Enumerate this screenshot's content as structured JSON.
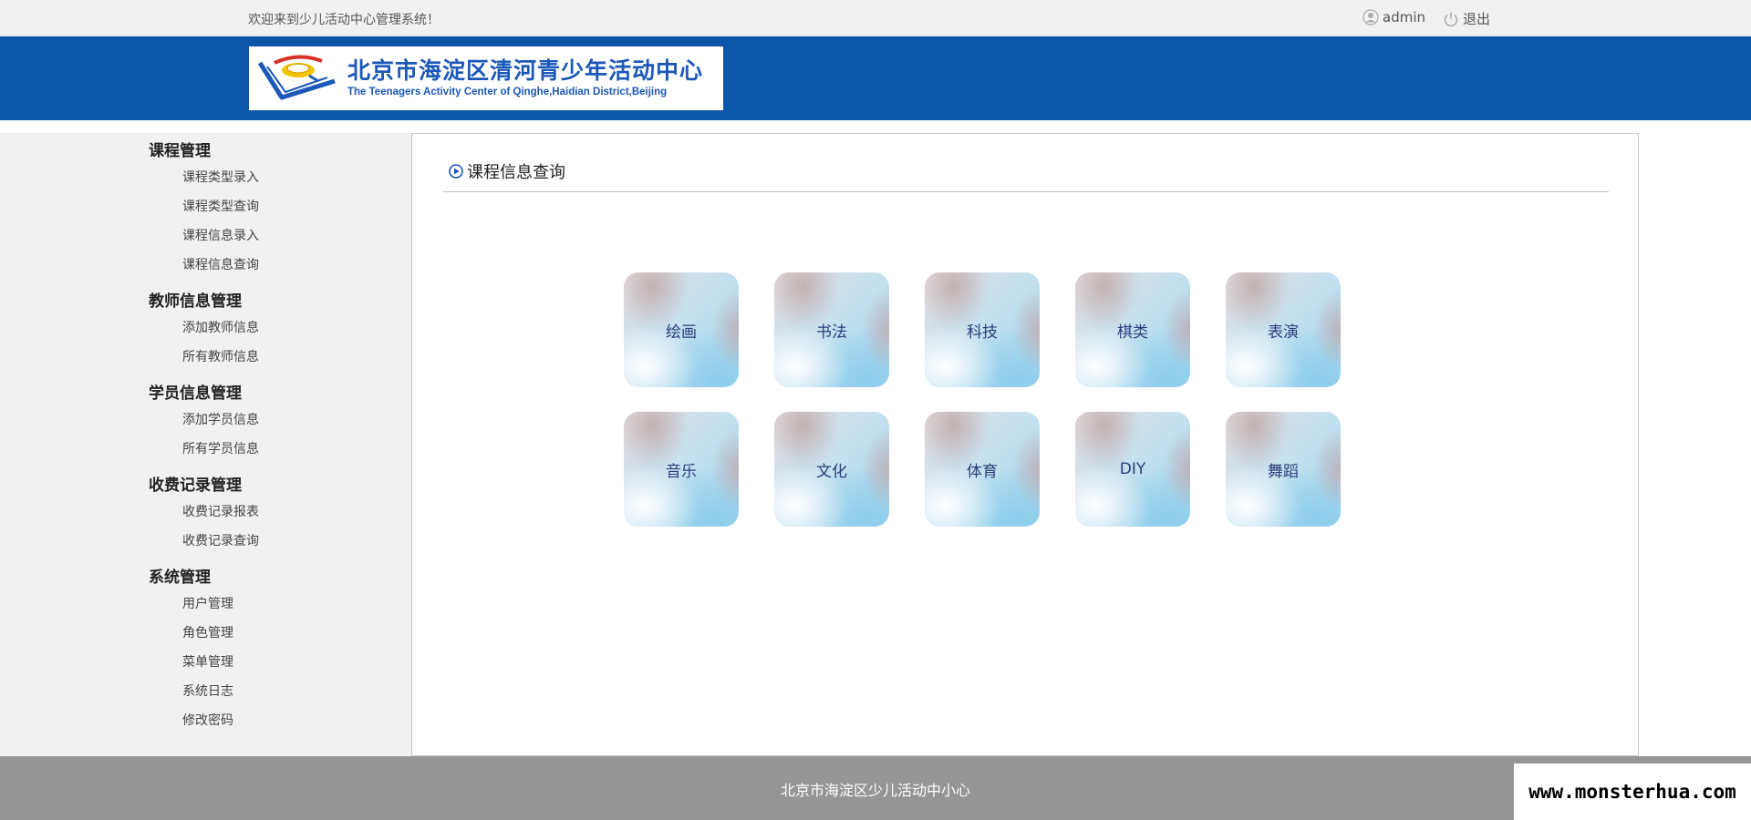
{
  "topbar": {
    "welcome": "欢迎来到少儿活动中心管理系统！",
    "user": "admin",
    "logout": "退出"
  },
  "banner": {
    "title_cn": "北京市海淀区清河青少年活动中心",
    "title_en": "The Teenagers Activity Center of Qinghe,Haidian District,Beijing"
  },
  "sidebar": {
    "groups": [
      {
        "title": "课程管理",
        "items": [
          "课程类型录入",
          "课程类型查询",
          "课程信息录入",
          "课程信息查询"
        ]
      },
      {
        "title": "教师信息管理",
        "items": [
          "添加教师信息",
          "所有教师信息"
        ]
      },
      {
        "title": "学员信息管理",
        "items": [
          "添加学员信息",
          "所有学员信息"
        ]
      },
      {
        "title": "收费记录管理",
        "items": [
          "收费记录报表",
          "收费记录查询"
        ]
      },
      {
        "title": "系统管理",
        "items": [
          "用户管理",
          "角色管理",
          "菜单管理",
          "系统日志",
          "修改密码"
        ]
      }
    ]
  },
  "main": {
    "heading": "课程信息查询",
    "categories": [
      "绘画",
      "书法",
      "科技",
      "棋类",
      "表演",
      "音乐",
      "文化",
      "体育",
      "DIY",
      "舞蹈"
    ]
  },
  "footer": {
    "text": "北京市海淀区少儿活动中小心"
  },
  "watermark": "www.monsterhua.com",
  "colors": {
    "banner_blue": "#0d55a8",
    "footer_gray": "#959595",
    "sidebar_bg": "#f1f1f1"
  }
}
